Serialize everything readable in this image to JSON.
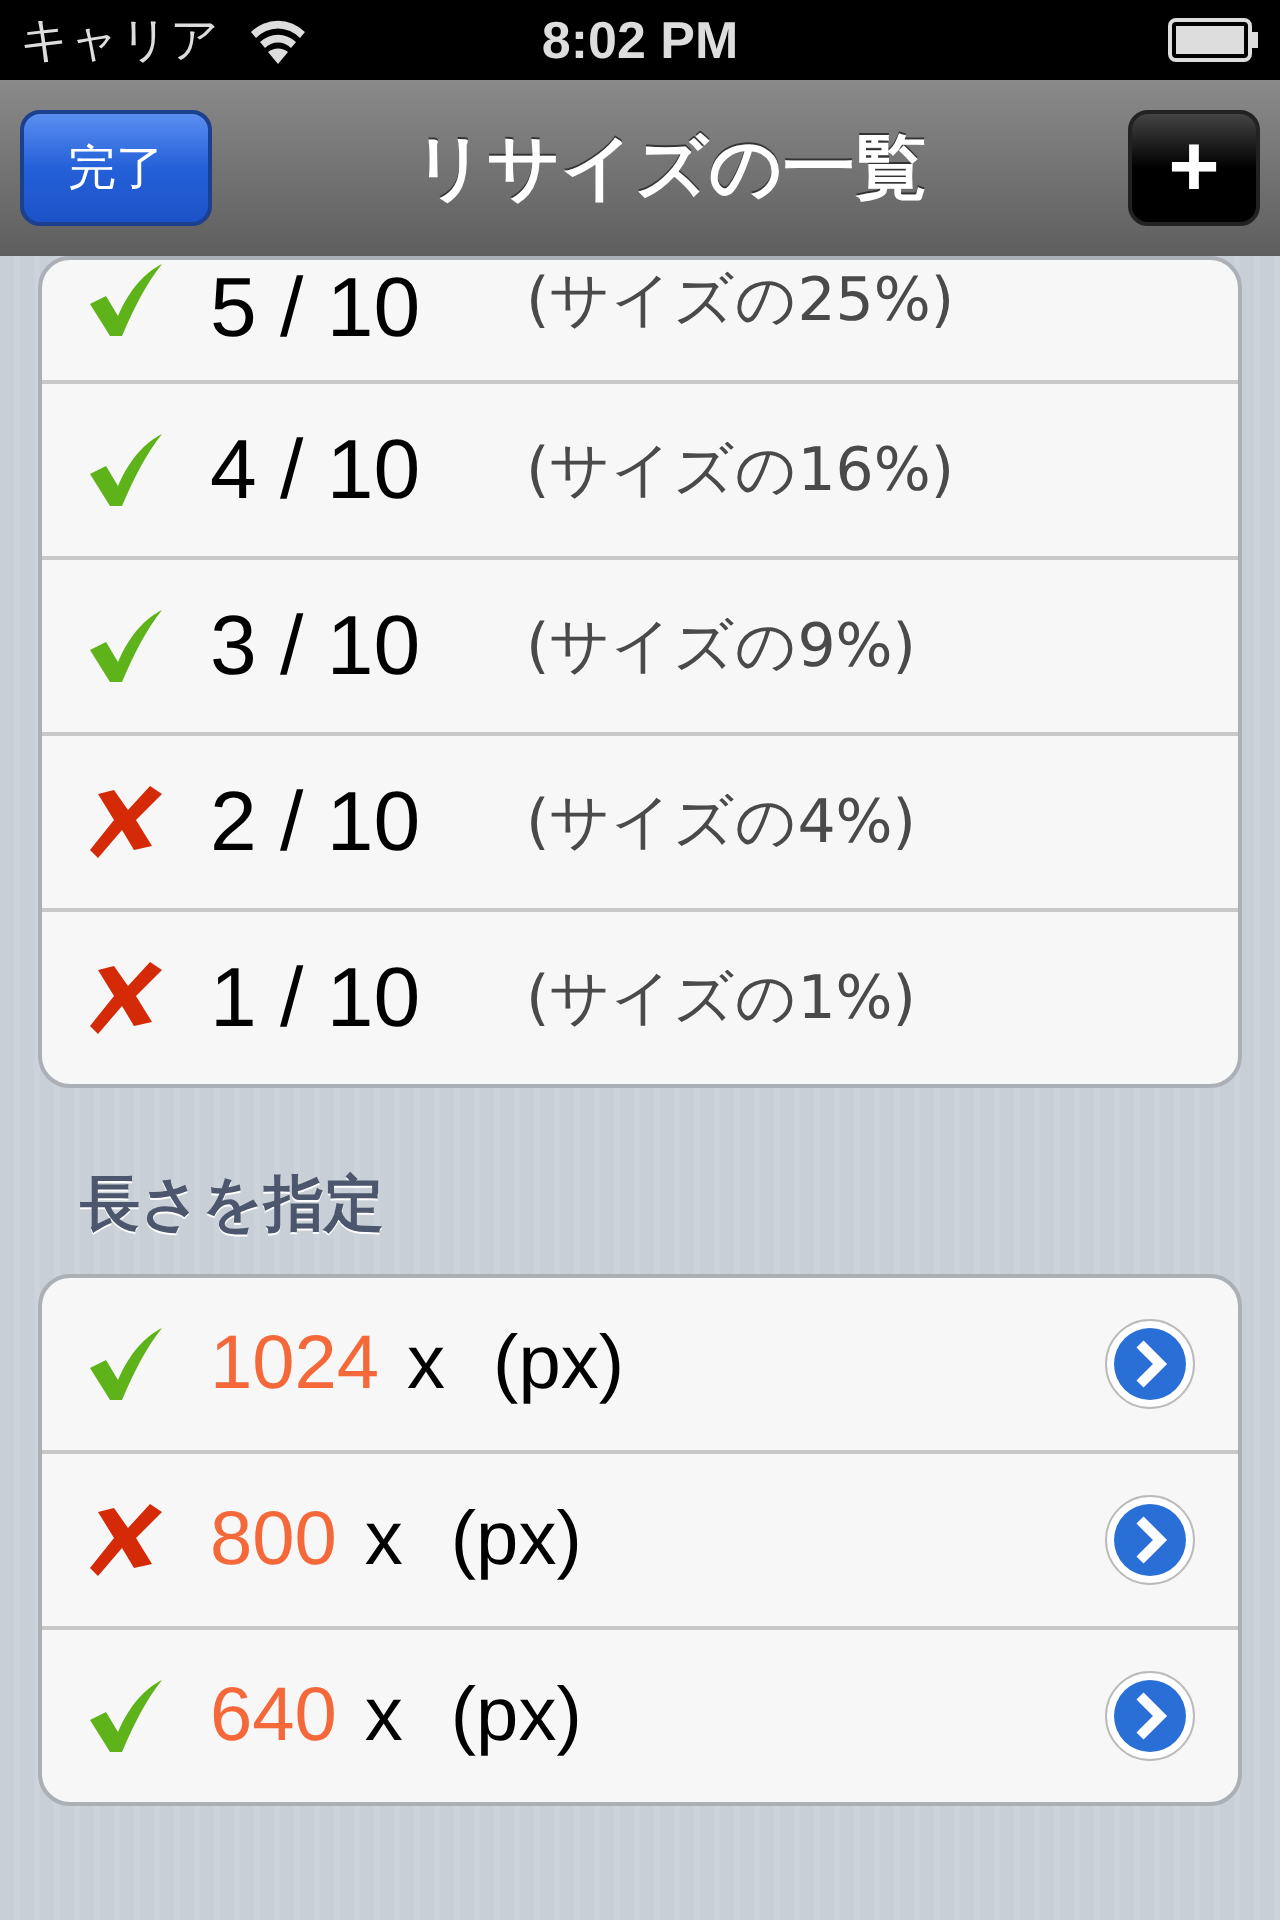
{
  "status_bar": {
    "carrier": "キャリア",
    "time": "8:02 PM"
  },
  "nav_bar": {
    "title": "リサイズの一覧",
    "done_button": "完了",
    "add_button": "+"
  },
  "ratio_rows": [
    {
      "ratio": "5 / 10",
      "note": "(サイズの25%)",
      "checked": true
    },
    {
      "ratio": "4 / 10",
      "note": "(サイズの16%)",
      "checked": true
    },
    {
      "ratio": "3 / 10",
      "note": "(サイズの9%)",
      "checked": true
    },
    {
      "ratio": "2 / 10",
      "note": "(サイズの4%)",
      "checked": false
    },
    {
      "ratio": "1 / 10",
      "note": "(サイズの1%)",
      "checked": false
    }
  ],
  "length_section": {
    "header": "長さを指定",
    "rows": [
      {
        "value": "1024",
        "suffix": "x",
        "unit": "(px)",
        "checked": true
      },
      {
        "value": "800",
        "suffix": "x",
        "unit": "(px)",
        "checked": false
      },
      {
        "value": "640",
        "suffix": "x",
        "unit": "(px)",
        "checked": true
      }
    ]
  }
}
